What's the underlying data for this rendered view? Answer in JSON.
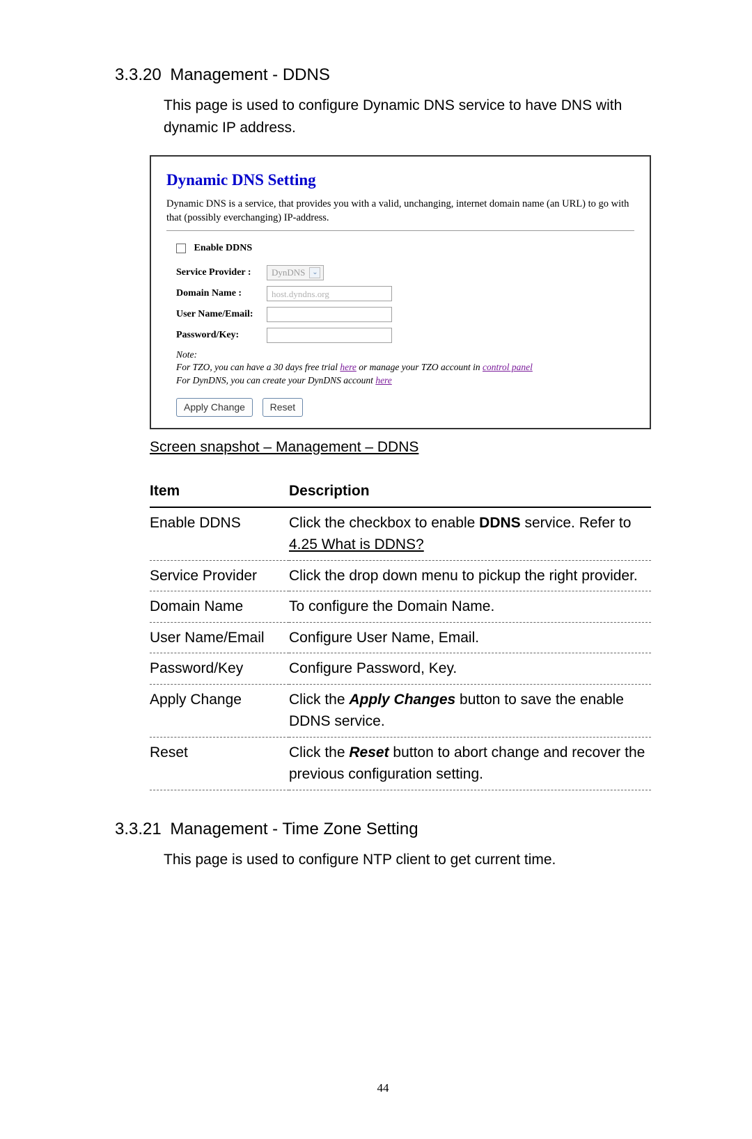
{
  "section1": {
    "number": "3.3.20",
    "title": "Management - DDNS",
    "intro": "This page is used to configure Dynamic DNS service to have DNS with dynamic IP address."
  },
  "screenshot": {
    "title": "Dynamic DNS  Setting",
    "desc": "Dynamic DNS is a service, that provides you with a valid, unchanging, internet domain name (an URL) to go with that (possibly everchanging) IP-address.",
    "enable_label": "Enable DDNS",
    "fields": {
      "service_provider_label": "Service Provider :",
      "service_provider_value": "DynDNS",
      "domain_name_label": "Domain Name :",
      "domain_name_placeholder": "host.dyndns.org",
      "user_label": "User Name/Email:",
      "pass_label": "Password/Key:"
    },
    "note_title": "Note:",
    "note_l1_a": "For TZO, you can have a 30 days free trial ",
    "note_l1_link1": "here",
    "note_l1_b": " or manage your TZO account in ",
    "note_l1_link2": "control panel",
    "note_l2_a": "For DynDNS, you can create your DynDNS account ",
    "note_l2_link": "here",
    "btn_apply": "Apply Change",
    "btn_reset": "Reset"
  },
  "caption": "Screen snapshot – Management – DDNS",
  "table": {
    "header_item": "Item",
    "header_desc": "Description",
    "rows": [
      {
        "item": "Enable DDNS",
        "desc_pre": "Click the checkbox to enable ",
        "desc_bold": "DDNS",
        "desc_post": " service. Refer to ",
        "desc_link": "4.25 What is DDNS?"
      },
      {
        "item": "Service Provider",
        "desc": "Click the drop down menu to pickup the right provider."
      },
      {
        "item": "Domain Name",
        "desc": "To configure the Domain Name."
      },
      {
        "item": "User Name/Email",
        "desc": "Configure User Name, Email."
      },
      {
        "item": "Password/Key",
        "desc": "Configure Password, Key."
      },
      {
        "item": "Apply Change",
        "desc_pre": "Click the ",
        "desc_bold": "Apply Changes",
        "desc_post": " button to save the enable DDNS service."
      },
      {
        "item": "Reset",
        "desc_pre": "Click the ",
        "desc_bold": "Reset",
        "desc_post": " button to abort change and recover the previous configuration setting."
      }
    ]
  },
  "section2": {
    "number": "3.3.21",
    "title": "Management - Time Zone Setting",
    "intro": "This page is used to configure NTP client to get current time."
  },
  "page_number": "44"
}
